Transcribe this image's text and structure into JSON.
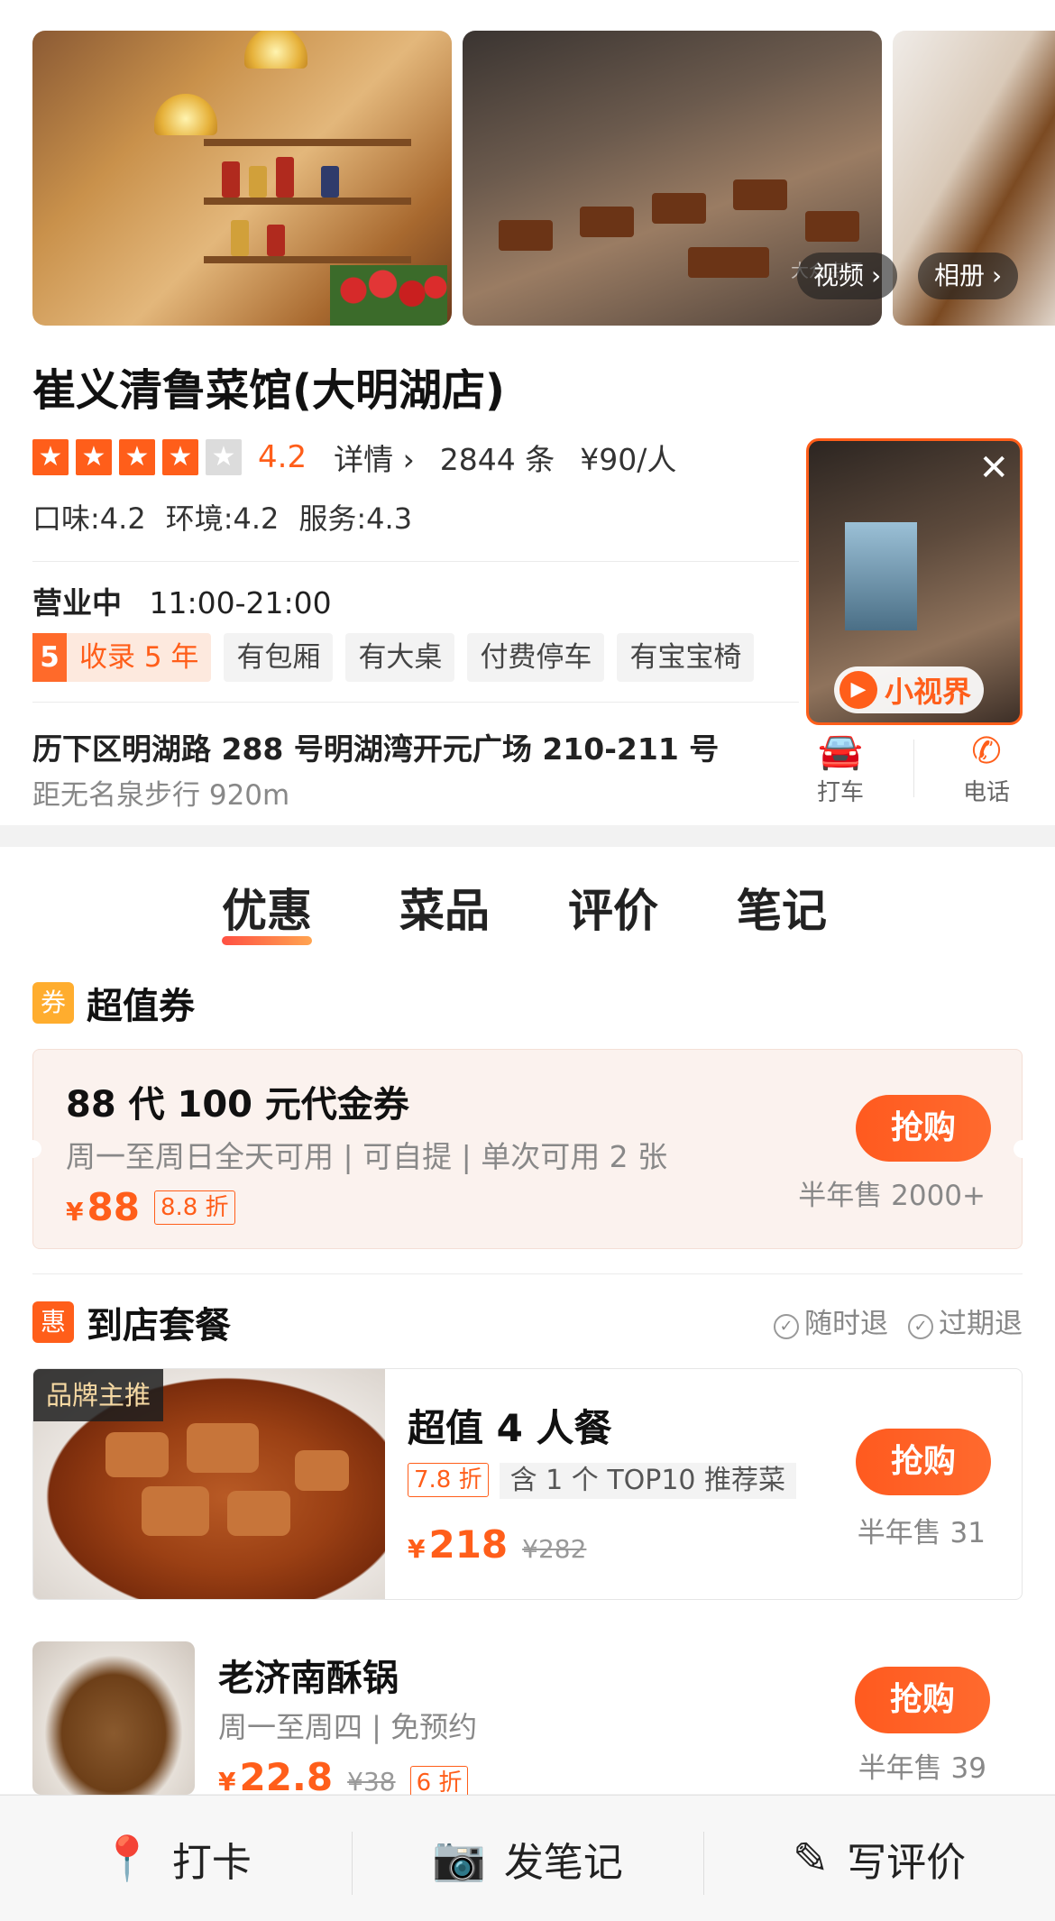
{
  "gallery": {
    "video_label": "视频",
    "album_label": "相册",
    "watermark": "大众点评"
  },
  "shop": {
    "name": "崔义清鲁菜馆(大明湖店)",
    "rating": "4.2",
    "rating_stars": 4,
    "details_label": "详情",
    "review_count": "2844 条",
    "price_per_person": "¥90/人",
    "sub_scores": [
      "口味:4.2",
      "环境:4.2",
      "服务:4.3"
    ],
    "status": "营业中",
    "hours": "11:00-21:00",
    "record_years_num": "5",
    "record_label": "收录 5 年",
    "tags": [
      "有包厢",
      "有大桌",
      "付费停车",
      "有宝宝椅"
    ],
    "address": "历下区明湖路 288 号明湖湾开元广场 210-211 号",
    "distance": "距无名泉步行 920m",
    "actions": {
      "taxi": "打车",
      "phone": "电话"
    }
  },
  "video_popup": {
    "badge": "小视界"
  },
  "tabs": [
    "优惠",
    "菜品",
    "评价",
    "笔记"
  ],
  "coupon_section": {
    "icon": "券",
    "title": "超值券",
    "coupon": {
      "name": "88 代 100 元代金券",
      "desc": "周一至周日全天可用 | 可自提 | 单次可用 2 张",
      "currency": "¥",
      "price": "88",
      "discount": "8.8 折",
      "buy_label": "抢购",
      "sold": "半年售 2000+"
    }
  },
  "set_section": {
    "icon": "惠",
    "title": "到店套餐",
    "flags": [
      "随时退",
      "过期退"
    ],
    "items": [
      {
        "brand_tag": "品牌主推",
        "title": "超值 4 人餐",
        "discount": "7.8 折",
        "tag": "含 1 个 TOP10 推荐菜",
        "currency": "¥",
        "price": "218",
        "original": "¥282",
        "buy_label": "抢购",
        "sold": "半年售 31"
      },
      {
        "title": "老济南酥锅",
        "desc": "周一至周四 | 免预约",
        "currency": "¥",
        "price": "22.8",
        "original": "¥38",
        "discount": "6 折",
        "buy_label": "抢购",
        "sold": "半年售 39"
      }
    ]
  },
  "bottom_bar": [
    "打卡",
    "发笔记",
    "写评价"
  ],
  "colors": {
    "accent": "#ff5e1a",
    "brand_tag_text": "#f6d9a3"
  }
}
